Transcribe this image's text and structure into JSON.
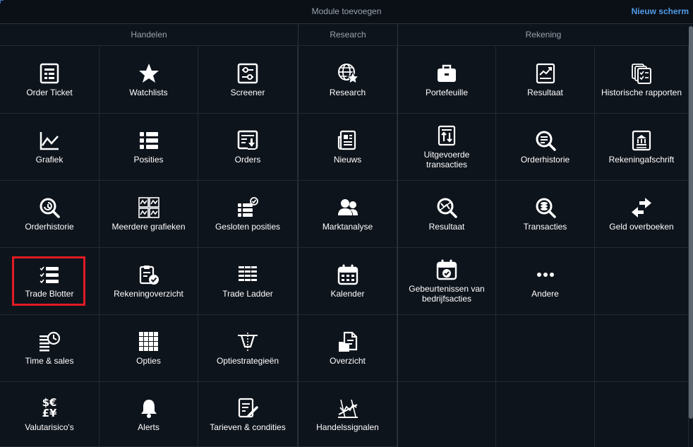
{
  "header": {
    "title": "Module toevoegen",
    "new_screen": "Nieuw scherm"
  },
  "sections": {
    "handelen": "Handelen",
    "research": "Research",
    "rekening": "Rekening"
  },
  "handelen": {
    "order_ticket": "Order Ticket",
    "watchlists": "Watchlists",
    "screener": "Screener",
    "grafiek": "Grafiek",
    "posities": "Posities",
    "orders": "Orders",
    "orderhistorie": "Orderhistorie",
    "meerdere_grafieken": "Meerdere grafieken",
    "gesloten_posities": "Gesloten posities",
    "trade_blotter": "Trade Blotter",
    "rekeningoverzicht": "Rekeningoverzicht",
    "trade_ladder": "Trade Ladder",
    "time_sales": "Time & sales",
    "opties": "Opties",
    "optiestrategieen": "Optiestrategieën",
    "valutarisico": "Valutarisico's",
    "alerts": "Alerts",
    "tarieven": "Tarieven & condities"
  },
  "research": {
    "research": "Research",
    "nieuws": "Nieuws",
    "marktanalyse": "Marktanalyse",
    "kalender": "Kalender",
    "overzicht": "Overzicht",
    "handelssignalen": "Handelssignalen"
  },
  "rekening": {
    "portefeuille": "Portefeuille",
    "resultaat": "Resultaat",
    "historische_rapporten": "Historische rapporten",
    "uitgevoerde_transacties": "Uitgevoerde transacties",
    "orderhistorie": "Orderhistorie",
    "rekeningafschrift": "Rekeningafschrift",
    "resultaat2": "Resultaat",
    "transacties": "Transacties",
    "geld_overboeken": "Geld overboeken",
    "gebeurtenissen": "Gebeurtenissen van bedrijfsacties",
    "andere": "Andere"
  },
  "currency_symbols": {
    "row1": "$€",
    "row2": "£¥"
  },
  "highlighted_tile": "Trade Blotter",
  "colors": {
    "accent": "#4f9be6",
    "highlight": "#e01b24",
    "background": "#0e141c"
  }
}
